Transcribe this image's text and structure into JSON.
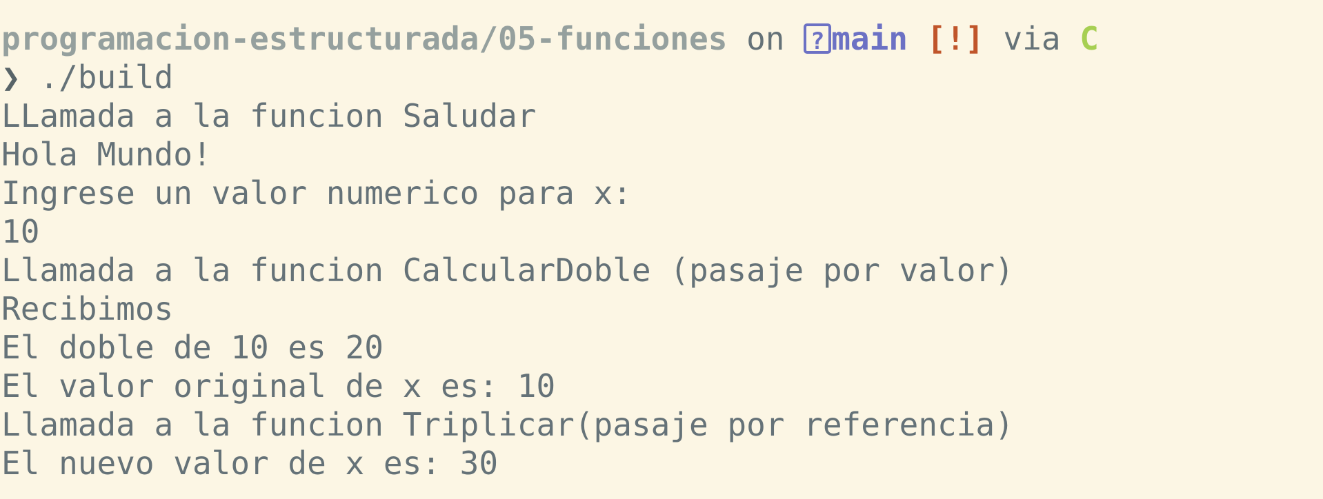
{
  "prompt": {
    "path": "programacion-estructurada/05-funciones",
    "on_text": "on",
    "git_icon_glyph": "?",
    "branch": "main",
    "status": "[!]",
    "via_text": "via",
    "language": "C",
    "symbol": "❯",
    "command": "./build"
  },
  "output": [
    "LLamada a la funcion Saludar",
    "Hola Mundo!",
    "Ingrese un valor numerico para x:",
    "10",
    "Llamada a la funcion CalcularDoble (pasaje por valor)",
    "Recibimos",
    "El doble de 10 es 20",
    "El valor original de x es: 10",
    "Llamada a la funcion Triplicar(pasaje por referencia)",
    "El nuevo valor de x es: 30"
  ],
  "colors": {
    "background": "#fcf6e4",
    "text": "#657278",
    "path": "#95a09e",
    "branch": "#6c71c4",
    "status": "#c0552a",
    "language": "#a7cf52"
  },
  "icons": {
    "git_branch": "git-branch-icon",
    "prompt": "prompt-chevron-icon"
  }
}
